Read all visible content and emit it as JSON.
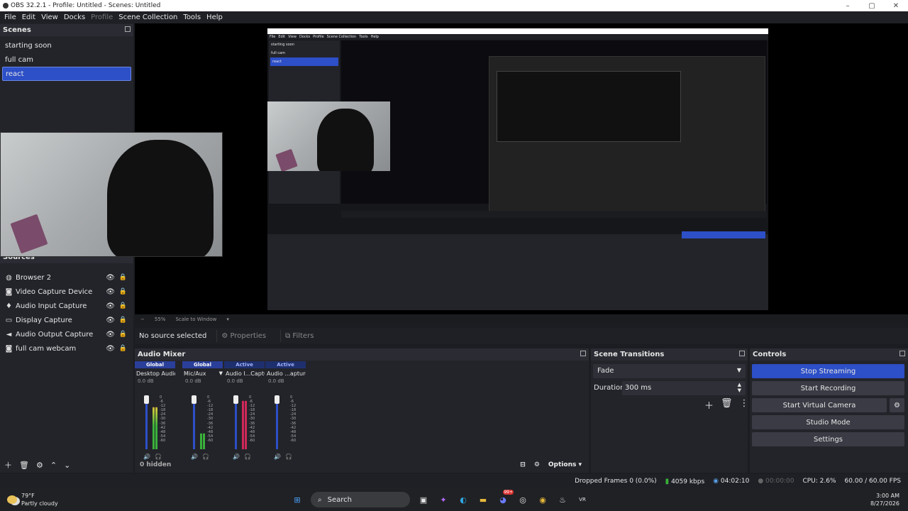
{
  "window": {
    "title": "OBS 32.2.1 - Profile: Untitled - Scenes: Untitled",
    "buttons": [
      "–",
      "▢",
      "✕"
    ]
  },
  "menu": [
    "File",
    "Edit",
    "View",
    "Docks",
    "Profile",
    "Scene Collection",
    "Tools",
    "Help"
  ],
  "scenes": {
    "title": "Scenes",
    "items": [
      "starting soon",
      "full cam",
      "react"
    ],
    "selected": 2
  },
  "sources": {
    "title": "Sources",
    "items": [
      {
        "label": "Browser 2",
        "icon": "globe-icon"
      },
      {
        "label": "Video Capture Device",
        "icon": "camera-icon"
      },
      {
        "label": "Audio Input Capture",
        "icon": "mic-icon"
      },
      {
        "label": "Display Capture",
        "icon": "monitor-icon"
      },
      {
        "label": "Audio Output Capture",
        "icon": "speaker-icon"
      },
      {
        "label": "full cam webcam",
        "icon": "camera-icon"
      }
    ]
  },
  "preview": {
    "zoom": "55%",
    "scale_mode": "Scale to Window"
  },
  "source_bar": {
    "text": "No source selected",
    "properties": "Properties",
    "filters": "Filters"
  },
  "mixer": {
    "title": "Audio Mixer",
    "channels": [
      {
        "badge": "Global",
        "name": "Desktop Audio",
        "db": "0.0 dB",
        "level": 0.8,
        "peak": false
      },
      {
        "badge": "Global",
        "name": "Mic/Aux",
        "db": "0.0 dB",
        "level": 0.3,
        "peak": false
      },
      {
        "badge": "Active",
        "name": "Audio I...Capture",
        "db": "0.0 dB",
        "level": 0.92,
        "peak": true
      },
      {
        "badge": "Active",
        "name": "Audio ...apture",
        "db": "0.0 dB",
        "level": 0.0,
        "peak": false
      }
    ],
    "scale": [
      "0",
      "-6",
      "-12",
      "-18",
      "-24",
      "-30",
      "-36",
      "-42",
      "-48",
      "-54",
      "-60"
    ],
    "hidden": "0 hidden",
    "options": "Options"
  },
  "transitions": {
    "title": "Scene Transitions",
    "type": "Fade",
    "duration_label": "Duration",
    "duration": "300 ms"
  },
  "controls": {
    "title": "Controls",
    "buttons": [
      "Stop Streaming",
      "Start Recording",
      "Start Virtual Camera",
      "Studio Mode",
      "Settings"
    ]
  },
  "status": {
    "dropped": "Dropped Frames 0 (0.0%)",
    "kbps": "4059 kbps",
    "stream_time": "04:02:10",
    "rec_time": "00:00:00",
    "cpu": "CPU: 2.6%",
    "fps": "60.00 / 60.00 FPS"
  },
  "taskbar": {
    "temp": "79°F",
    "weather": "Partly cloudy",
    "search": "Search",
    "time": "3:00 AM",
    "date": "8/27/2026",
    "badge": "99+"
  },
  "nested": {
    "menu": [
      "File",
      "Edit",
      "View",
      "Docks",
      "Profile",
      "Scene Collection",
      "Tools",
      "Help"
    ],
    "scenes": [
      "starting soon",
      "full cam",
      "react"
    ]
  },
  "colors": {
    "accent": "#2d4fc7",
    "panel": "#23242a",
    "meter_green": "#3ab13a",
    "meter_peak": "#d1285a"
  }
}
